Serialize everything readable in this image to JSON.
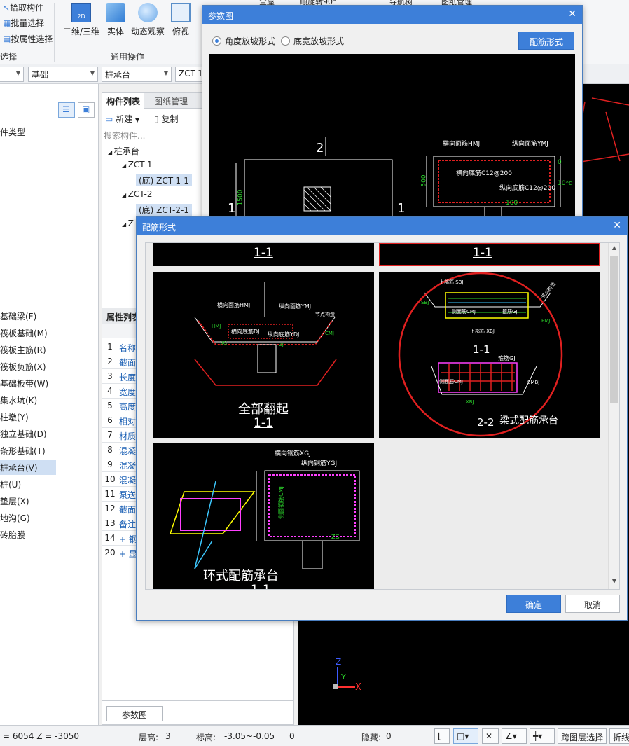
{
  "ribbon": {
    "select_items": [
      "拾取构件",
      "批量选择",
      "按属性选择"
    ],
    "select_group_label": "选择",
    "buttons": [
      {
        "label": "二维/三维",
        "icon": "2d-3d-icon"
      },
      {
        "label": "实体",
        "icon": "solid-cube-icon"
      },
      {
        "label": "动态观察",
        "icon": "orbit-icon"
      },
      {
        "label": "俯视",
        "icon": "top-view-icon"
      }
    ],
    "common_group_label": "通用操作"
  },
  "combos": [
    "",
    "基础",
    "桩承台",
    "ZCT-1"
  ],
  "left_panel": {
    "type_label": "件类型",
    "items": [
      "基础梁(F)",
      "筏板基础(M)",
      "筏板主筋(R)",
      "筏板负筋(X)",
      "基础板带(W)",
      "集水坑(K)",
      "柱墩(Y)",
      "独立基础(D)",
      "条形基础(T)",
      "桩承台(V)",
      "桩(U)",
      "垫层(X)",
      "地沟(G)",
      "砖胎膜"
    ],
    "selected_index": 9
  },
  "mid_panel": {
    "tabs": [
      "构件列表",
      "图纸管理"
    ],
    "new_label": "新建",
    "copy_label": "复制",
    "search_placeholder": "搜索构件...",
    "tree": [
      {
        "label": "桩承台",
        "level": 0
      },
      {
        "label": "ZCT-1",
        "level": 1
      },
      {
        "label": "(底) ZCT-1-1",
        "level": 2
      },
      {
        "label": "ZCT-2",
        "level": 1
      },
      {
        "label": "(底) ZCT-2-1",
        "level": 2
      },
      {
        "label": "Z",
        "level": 1
      }
    ],
    "props_title": "属性列表",
    "props": [
      {
        "num": "1",
        "name": "名称"
      },
      {
        "num": "2",
        "name": "截面"
      },
      {
        "num": "3",
        "name": "长度"
      },
      {
        "num": "4",
        "name": "宽度"
      },
      {
        "num": "5",
        "name": "高度"
      },
      {
        "num": "6",
        "name": "相对"
      },
      {
        "num": "7",
        "name": "材质"
      },
      {
        "num": "8",
        "name": "混凝"
      },
      {
        "num": "9",
        "name": "混凝"
      },
      {
        "num": "10",
        "name": "混凝"
      },
      {
        "num": "11",
        "name": "泵送"
      },
      {
        "num": "12",
        "name": "截面"
      },
      {
        "num": "13",
        "name": "备注"
      },
      {
        "num": "14",
        "name": "+ 钢"
      },
      {
        "num": "20",
        "name": "+ 显"
      }
    ],
    "param_button": "参数图"
  },
  "top_strip": {
    "items": [
      "全屋",
      "顺旋转90°",
      "导航树",
      "图纸管理"
    ]
  },
  "dialog_param": {
    "title": "参数图",
    "radio1": "角度放坡形式",
    "radio2": "底宽放坡形式",
    "radio_selected": 1,
    "config_button": "配筋形式",
    "drawing": {
      "section_num": "2",
      "label1": "1",
      "dim1500": "1500",
      "dim500": "500",
      "dim100": "100",
      "dim10d": "10*d",
      "dim0": "0",
      "h_top": "横向面筋HMJ",
      "v_top": "纵向面筋YMJ",
      "h_bottom": "横向底筋C12@200",
      "v_bottom": "纵向底筋C12@200",
      "side": "侧面筋C12@200"
    }
  },
  "dialog_config": {
    "title": "配筋形式",
    "ok": "确定",
    "cancel": "取消",
    "thumbs": [
      {
        "caption": "1-1"
      },
      {
        "caption": "1-1"
      },
      {
        "caption": "全部翻起",
        "sub": "1-1",
        "labels": [
          "横向面筋HMJ",
          "纵向面筋YMJ",
          "横向底筋DJ",
          "纵向底筋YDJ",
          "CMJ",
          "HMJ",
          "XG",
          "节点构造",
          "ZJ"
        ]
      },
      {
        "caption": "梁式配筋承台",
        "sub": "1-1",
        "sub2": "2-2",
        "labels": [
          "上部筋 SBJ",
          "侧面筋CMJ",
          "箍筋GJ",
          "下部筋 XBJ",
          "SBJ",
          "PMJ",
          "箍筋GJ",
          "侧面筋CMJ",
          "SMBJ",
          "XBJ",
          "节点构造"
        ]
      },
      {
        "caption": "环式配筋承台",
        "sub": "1-1",
        "labels": [
          "横向钢筋XGJ",
          "纵向钢筋YGJ",
          "侧面钢筋CMJ",
          "ZG"
        ]
      }
    ]
  },
  "status": {
    "coord": "= 6054 Z = -3050",
    "floor_label": "层高:",
    "floor_value": "3",
    "elev_label": "标高:",
    "elev_value": "-3.05~-0.05",
    "zero": "0",
    "hidden_label": "隐藏:",
    "hidden_value": "0",
    "cross_layer": "跨图层选择",
    "polyline": "折线"
  },
  "axis": {
    "z": "Z",
    "y": "Y",
    "x": "X"
  },
  "colors": {
    "accent": "#3d7fd9",
    "cad_bg": "#000000",
    "highlight_red": "#e02020"
  }
}
